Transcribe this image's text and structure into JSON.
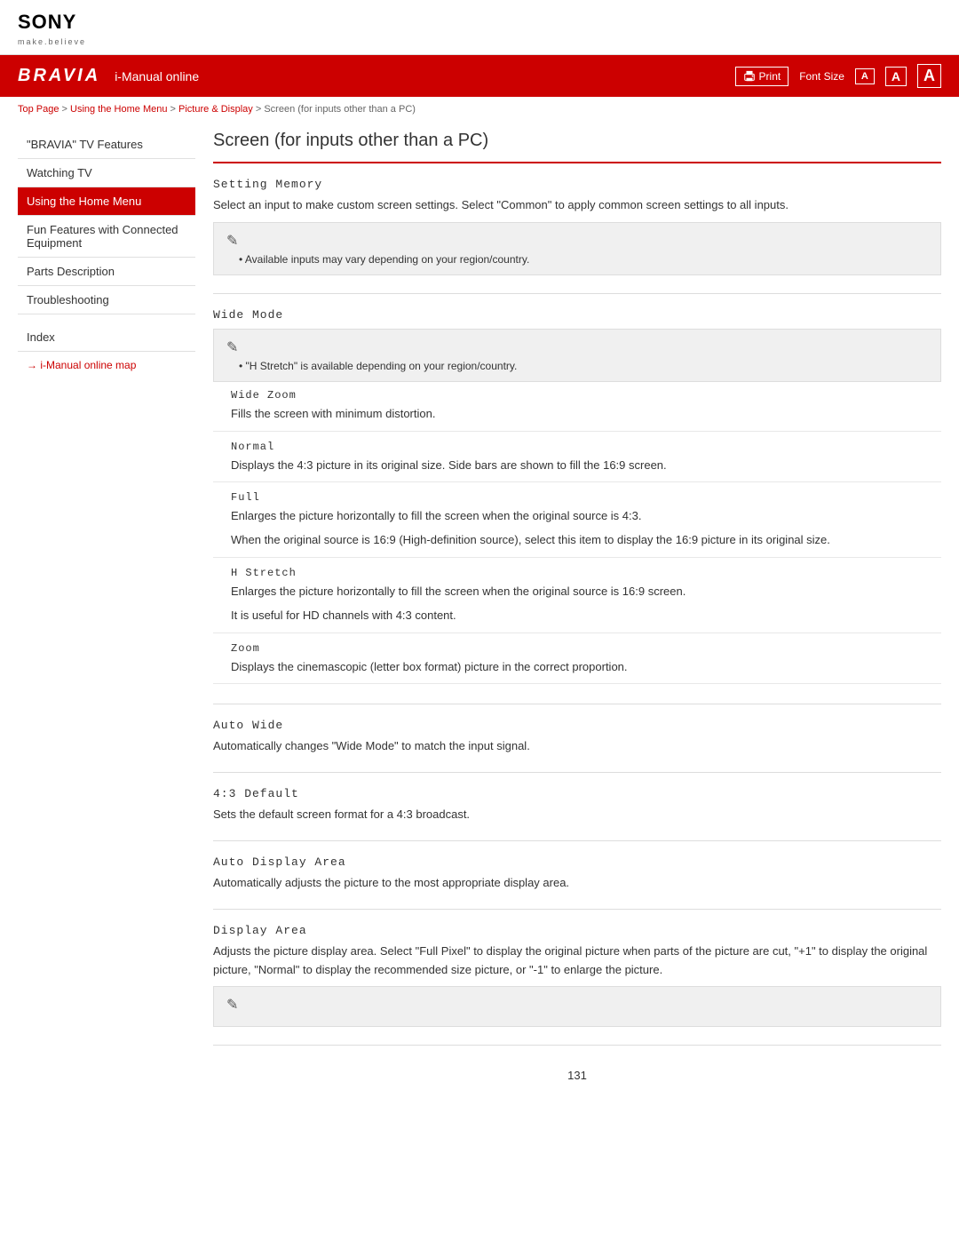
{
  "header": {
    "sony_logo": "SONY",
    "sony_tagline": "make.believe",
    "bravia_logo": "BRAVIA",
    "nav_title": "i-Manual online",
    "print_label": "Print",
    "font_size_label": "Font Size",
    "font_a_small": "A",
    "font_a_medium": "A",
    "font_a_large": "A"
  },
  "breadcrumb": {
    "top_page": "Top Page",
    "sep1": " > ",
    "using_home_menu": "Using the Home Menu",
    "sep2": " > ",
    "picture_display": "Picture & Display",
    "sep3": " > ",
    "current": "Screen (for inputs other than a PC)"
  },
  "sidebar": {
    "items": [
      {
        "label": "\"BRAVIA\" TV Features",
        "active": false
      },
      {
        "label": "Watching TV",
        "active": false
      },
      {
        "label": "Using the Home Menu",
        "active": true
      },
      {
        "label": "Fun Features with Connected Equipment",
        "active": false
      },
      {
        "label": "Parts Description",
        "active": false
      },
      {
        "label": "Troubleshooting",
        "active": false
      }
    ],
    "index_label": "Index",
    "map_link": "→ i-Manual online map"
  },
  "content": {
    "page_title": "Screen (for inputs other than a PC)",
    "sections": [
      {
        "id": "setting-memory",
        "title": "Setting Memory",
        "desc": "Select an input to make custom screen settings. Select \"Common\" to apply common screen settings to all inputs.",
        "note": {
          "text": "Available inputs may vary depending on your region/country."
        }
      },
      {
        "id": "wide-mode",
        "title": "Wide Mode",
        "note": {
          "text": "\"H Stretch\" is available depending on your region/country."
        },
        "sub_sections": [
          {
            "id": "wide-zoom",
            "title": "Wide Zoom",
            "desc": "Fills the screen with minimum distortion."
          },
          {
            "id": "normal",
            "title": "Normal",
            "desc": "Displays the 4:3 picture in its original size. Side bars are shown to fill the 16:9 screen."
          },
          {
            "id": "full",
            "title": "Full",
            "desc": "Enlarges the picture horizontally to fill the screen when the original source is 4:3.",
            "desc2": "When the original source is 16:9 (High-definition source), select this item to display the 16:9 picture in its original size."
          },
          {
            "id": "h-stretch",
            "title": "H Stretch",
            "desc": "Enlarges the picture horizontally to fill the screen when the original source is 16:9 screen.",
            "desc2": "It is useful for HD channels with 4:3 content."
          },
          {
            "id": "zoom",
            "title": "Zoom",
            "desc": "Displays the cinemascopic (letter box format) picture in the correct proportion."
          }
        ]
      },
      {
        "id": "auto-wide",
        "title": "Auto Wide",
        "desc": "Automatically changes \"Wide Mode\" to match the input signal."
      },
      {
        "id": "43-default",
        "title": "4:3 Default",
        "desc": "Sets the default screen format for a 4:3 broadcast."
      },
      {
        "id": "auto-display-area",
        "title": "Auto Display Area",
        "desc": "Automatically adjusts the picture to the most appropriate display area."
      },
      {
        "id": "display-area",
        "title": "Display Area",
        "desc": "Adjusts the picture display area. Select \"Full Pixel\" to display the original picture when parts of the picture are cut, \"+1\" to display the original picture, \"Normal\" to display the recommended size picture, or \"-1\" to enlarge the picture.",
        "has_note": true
      }
    ],
    "page_number": "131"
  }
}
